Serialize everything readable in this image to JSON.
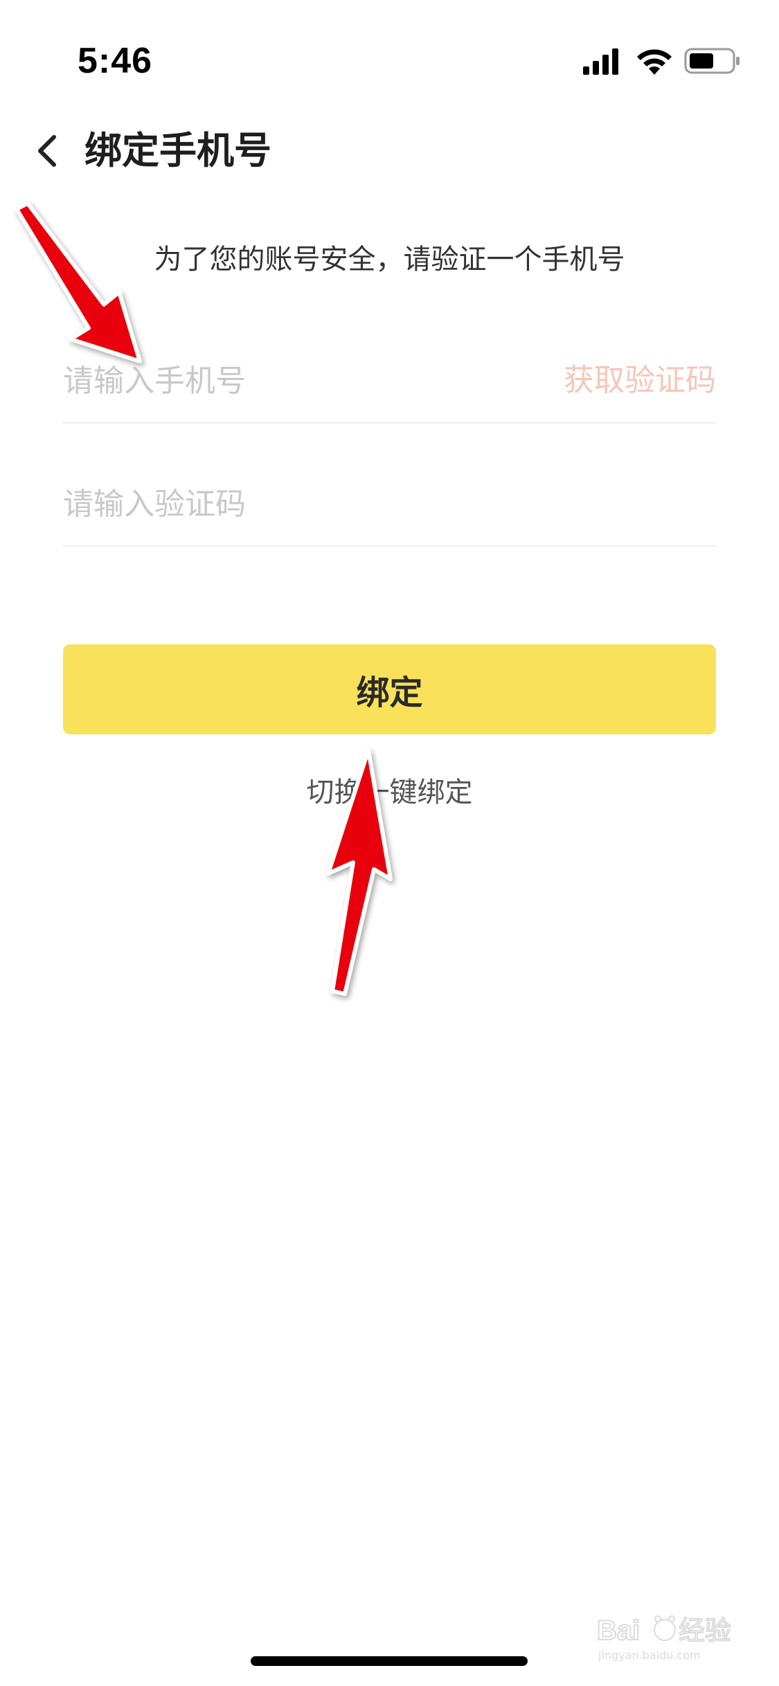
{
  "status_bar": {
    "time": "5:46"
  },
  "header": {
    "title": "绑定手机号",
    "back_icon": "chevron-left-icon"
  },
  "subtitle": "为了您的账号安全，请验证一个手机号",
  "form": {
    "phone_placeholder": "请输入手机号",
    "phone_value": "",
    "get_code_label": "获取验证码",
    "code_placeholder": "请输入验证码",
    "code_value": ""
  },
  "bind_button_label": "绑定",
  "switch_link_label": "切换一键绑定",
  "colors": {
    "button_bg": "#f9e15a",
    "get_code_text": "#f6c6b8",
    "annotation_arrow": "#e8000b"
  },
  "watermark": {
    "text": "Baidu经验",
    "subtext": "jingyan.baidu.com"
  }
}
